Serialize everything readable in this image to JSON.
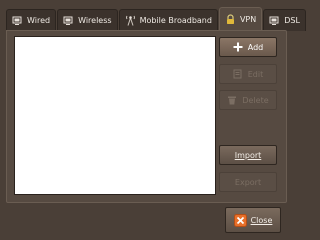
{
  "tabs": [
    {
      "label": "Wired",
      "icon": "network-wired-icon"
    },
    {
      "label": "Wireless",
      "icon": "network-wireless-icon"
    },
    {
      "label": "Mobile Broadband",
      "icon": "antenna-icon"
    },
    {
      "label": "VPN",
      "icon": "lock-icon",
      "active": true
    },
    {
      "label": "DSL",
      "icon": "network-dsl-icon"
    }
  ],
  "buttons": {
    "add": "Add",
    "edit": "Edit",
    "delete": "Delete",
    "import": "Import",
    "export": "Export"
  },
  "close": "Close",
  "colors": {
    "window_bg": "#4a3f37",
    "panel_bg": "#564a41",
    "list_bg": "#ffffff",
    "close_icon_bg": "#e8702a"
  }
}
